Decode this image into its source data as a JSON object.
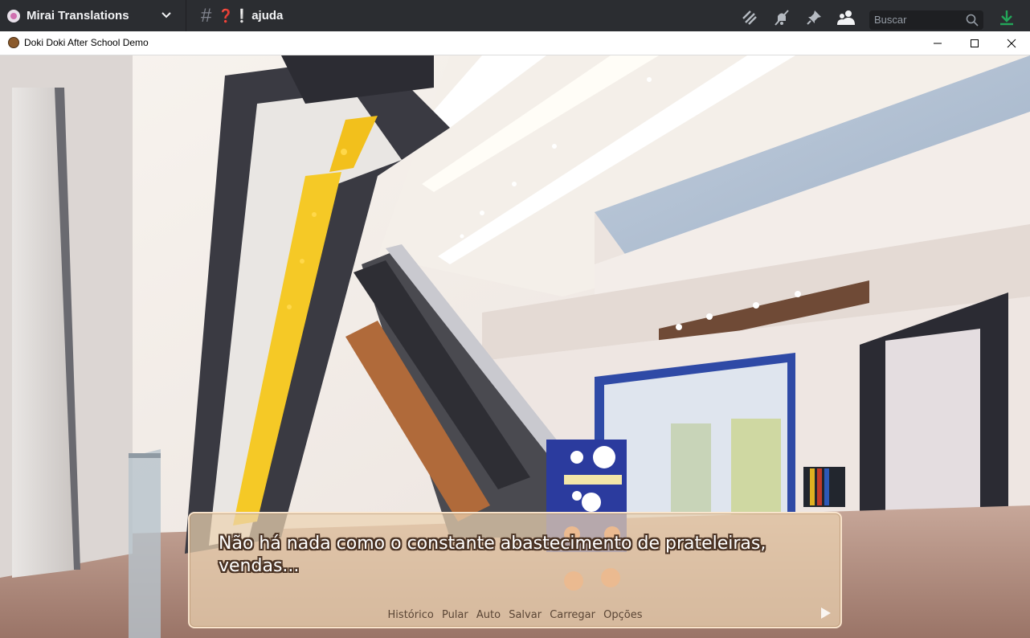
{
  "discord": {
    "server_name": "Mirai Translations",
    "channel_prefix": "❓❕",
    "channel_name": "ajuda",
    "search_placeholder": "Buscar",
    "icons": [
      "threads-icon",
      "mute-bell-icon",
      "pin-icon",
      "members-icon",
      "search-icon",
      "download-icon"
    ],
    "accent": "#23a559"
  },
  "window": {
    "title": "Doki Doki After School Demo",
    "controls": [
      "minimize",
      "maximize",
      "close"
    ]
  },
  "game": {
    "dialogue_line1": "Não há nada como o constante abastecimento de prateleiras,",
    "dialogue_line2": "vendas...",
    "quick_menu": {
      "history": "Histórico",
      "skip": "Pular",
      "auto": "Auto",
      "save": "Salvar",
      "load": "Carregar",
      "options": "Opções"
    }
  }
}
